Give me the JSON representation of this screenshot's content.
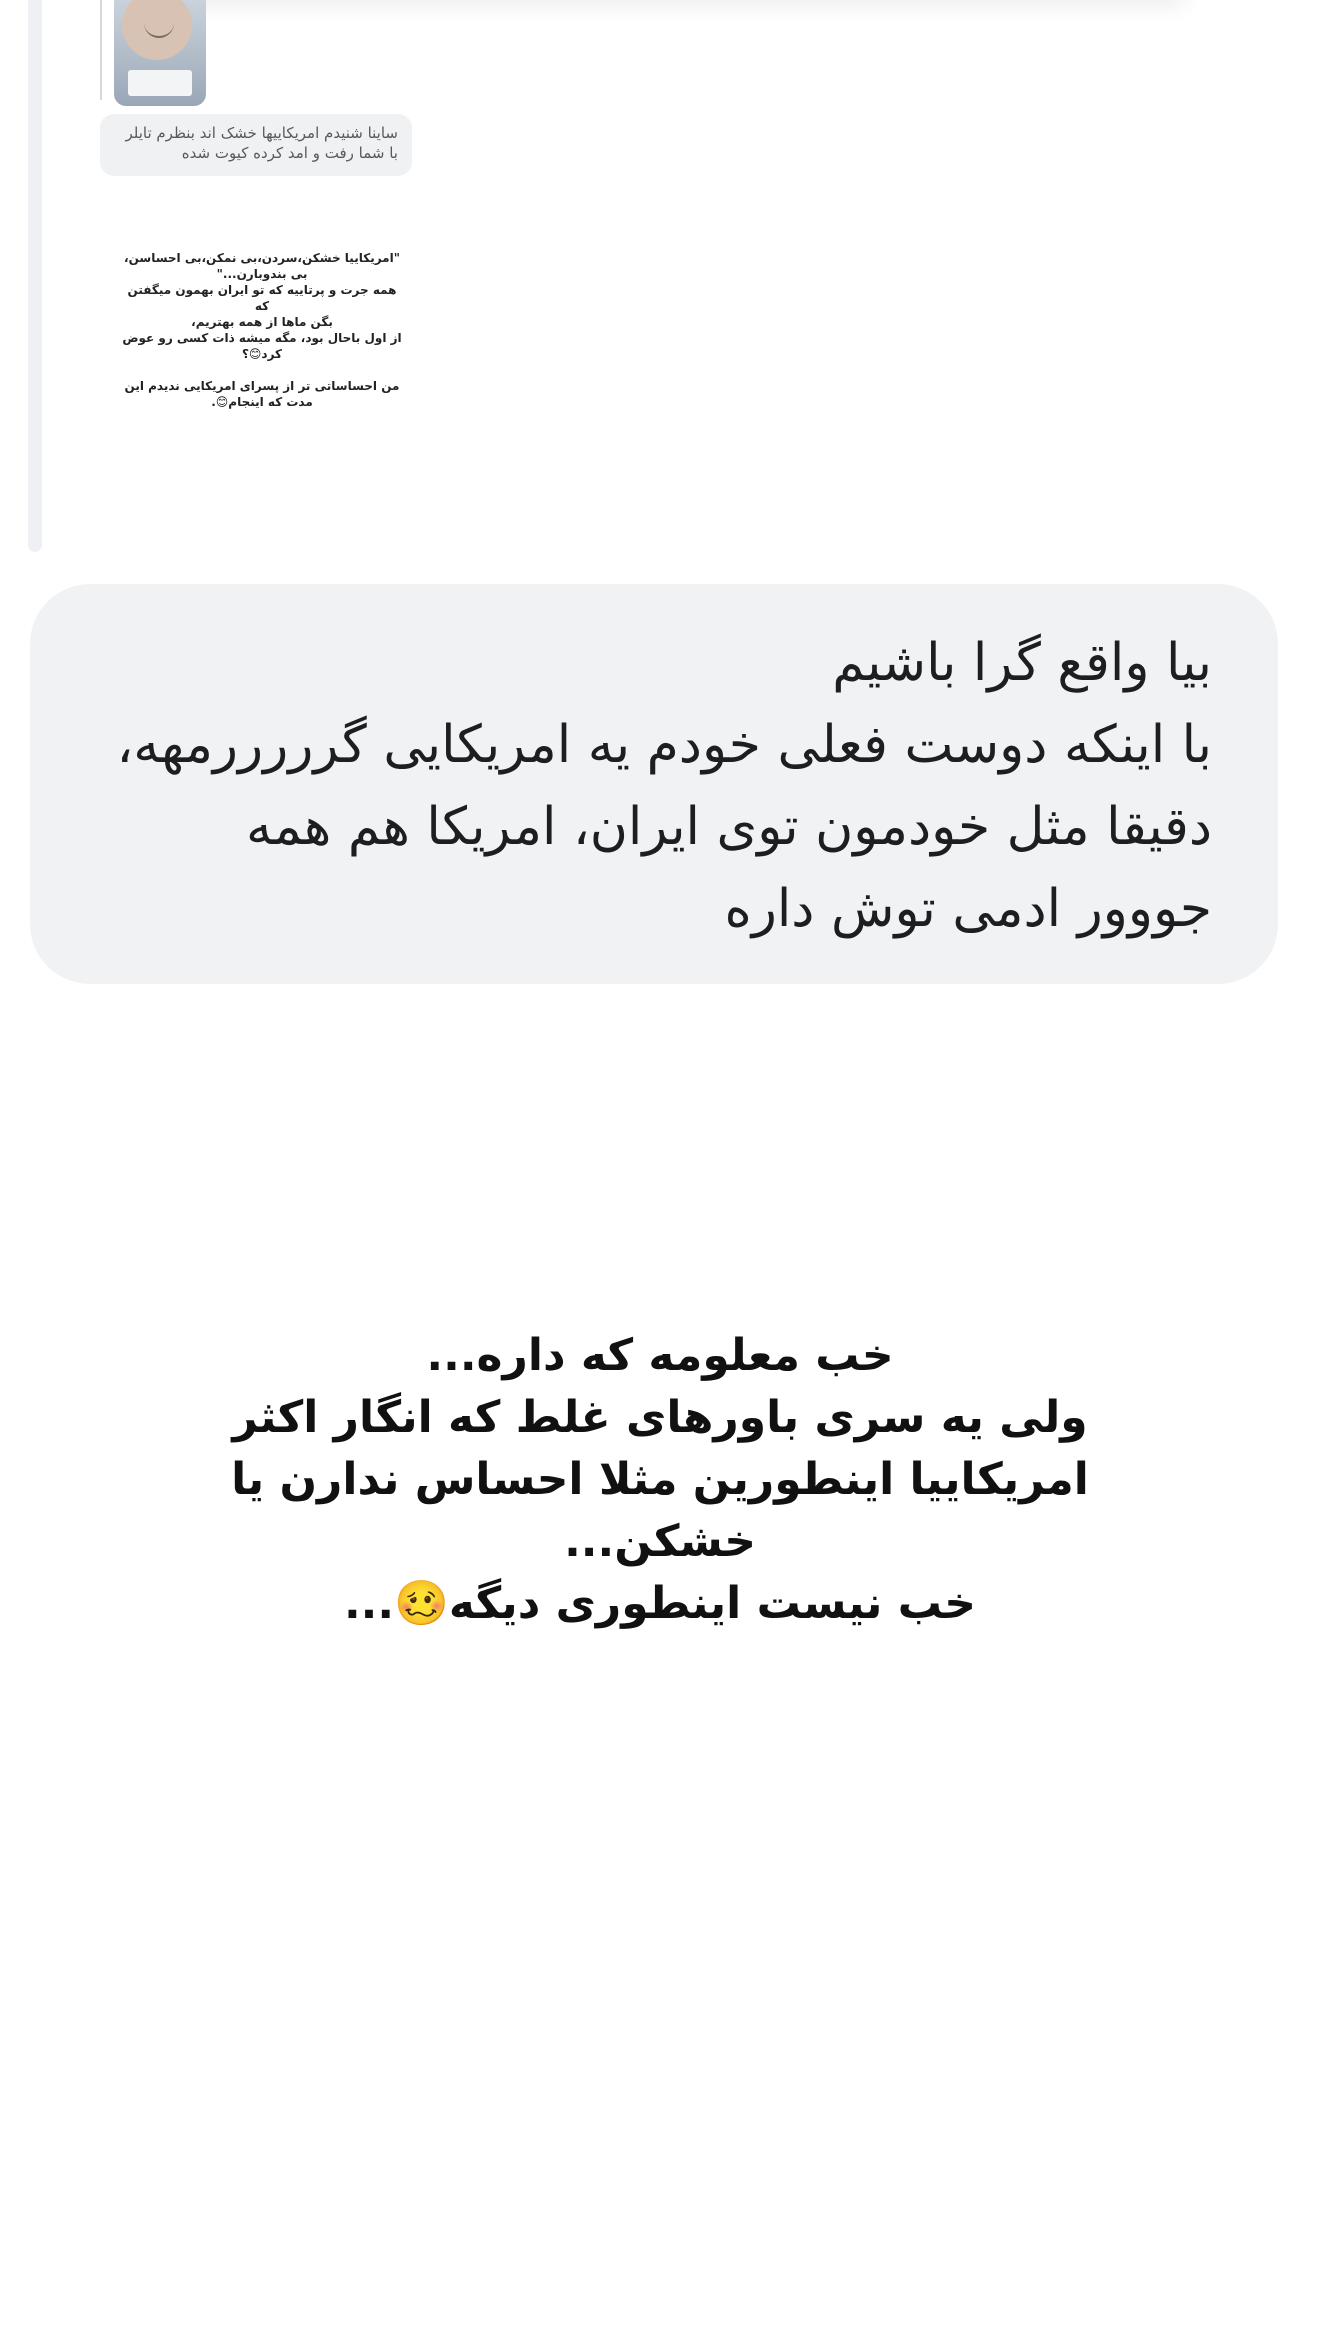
{
  "reply_preview": {
    "thumbnail_icon": "photo-thumbnail",
    "quoted_comment": "ساینا شنیدم امریکاییها خشک اند بنظرم تایلر با شما رفت و امد کرده کیوت شده",
    "story_text": "\"امریکاییا خشکن،سردن،بی نمکن،بی احساسن،\nبی بندوبارن...\"\nهمه جرت و پرتاییه که تو ایران بهمون میگفتن که\nبگن ماها از همه بهتریم،\nاز اول باحال بود، مگه میشه ذات کسی رو عوض\nکرد😊؟\n\nمن احساساتی تر از پسرای امریکایی ندیدم این\nمدت که اینجام😊."
  },
  "message": {
    "lines": [
      "بیا واقع گرا باشیم",
      "با اینکه دوست فعلی خودم یه امریکایی گرررررمهه،",
      "دقیقا مثل خودمون توی ایران، امریکا هم همه",
      "جووور ادمی توش داره"
    ]
  },
  "caption": {
    "lines": [
      "خب معلومه که داره...",
      "ولی یه سری باورهای غلط که انگار اکثر",
      "امریکاییا اینطورین مثلا احساس ندارن یا",
      "خشکن...",
      "خب نیست اینطوری دیگه🥴..."
    ]
  },
  "colors": {
    "bubble_bg": "#f1f2f4",
    "text": "#1c1e21",
    "quote_bar": "#eef0f3"
  }
}
